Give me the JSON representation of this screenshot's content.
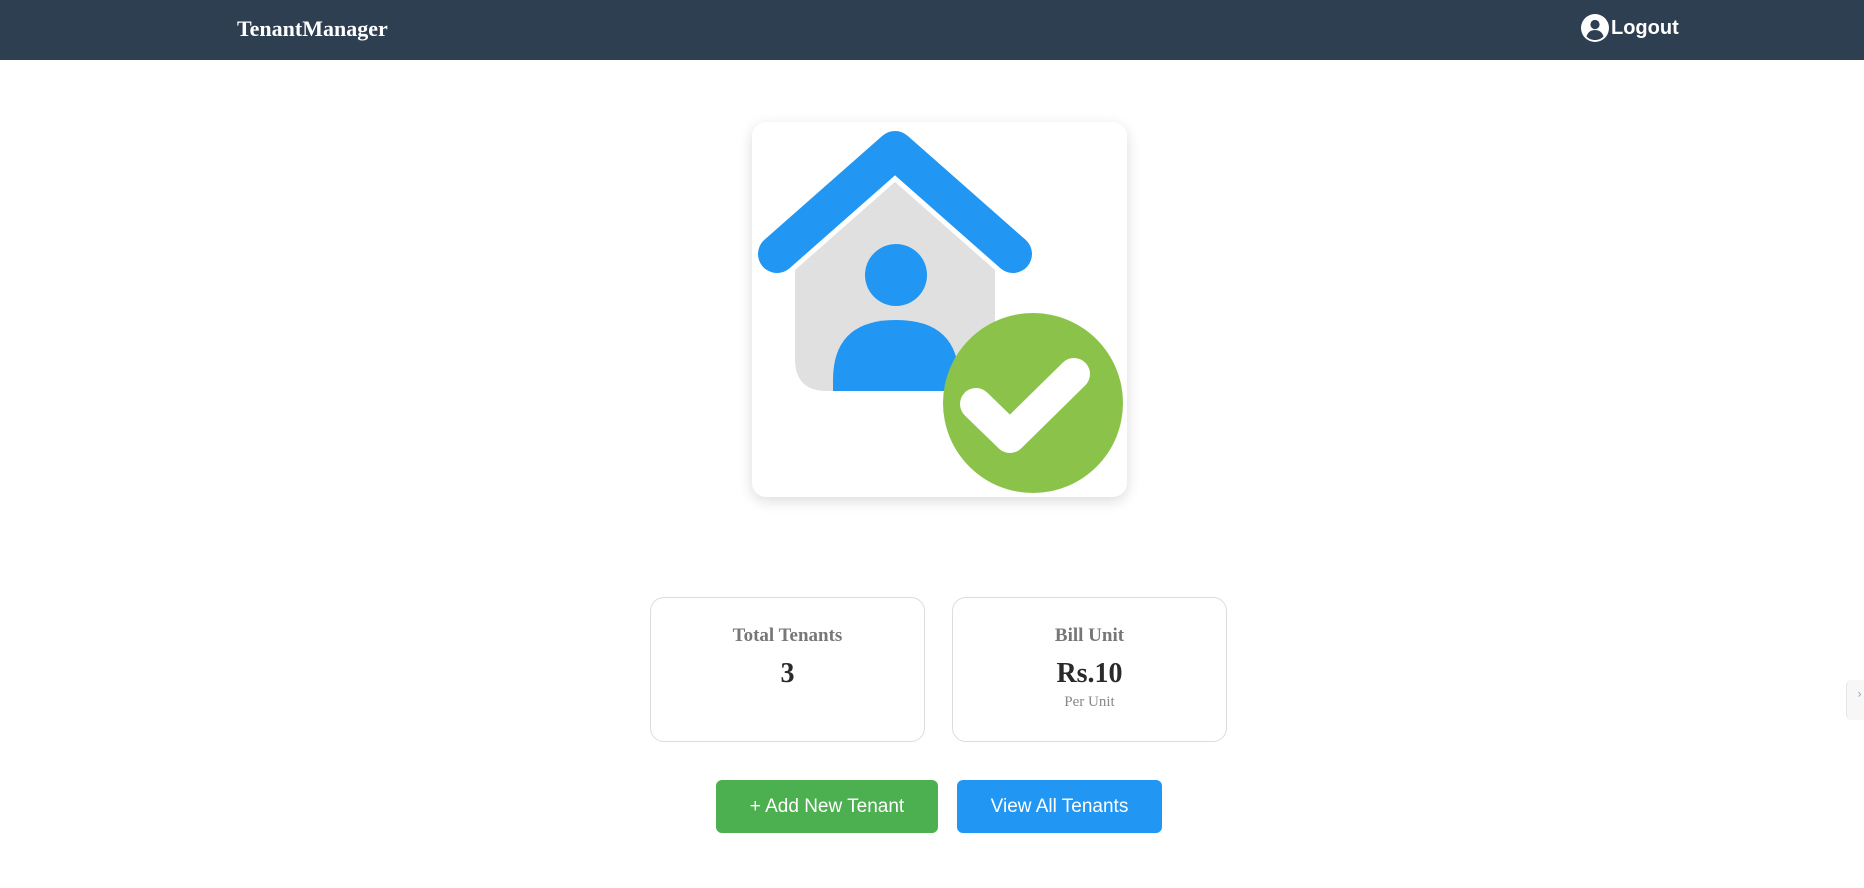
{
  "navbar": {
    "brand": "TenantManager",
    "logout_label": "Logout",
    "logout_icon": "user-circle-icon"
  },
  "hero": {
    "icon": "house-tenant-check-icon",
    "colors": {
      "roof": "#2196f3",
      "person": "#2196f3",
      "house_body": "#e0e0e0",
      "check_circle": "#8bc34a",
      "check_mark": "#ffffff"
    }
  },
  "stats": {
    "total_tenants": {
      "label": "Total Tenants",
      "value": "3"
    },
    "bill_unit": {
      "label": "Bill Unit",
      "value": "Rs.10",
      "sub": "Per Unit"
    }
  },
  "actions": {
    "add_label": "+ Add New Tenant",
    "view_label": "View All Tenants",
    "add_color": "#4caf50",
    "view_color": "#2196f3"
  },
  "edge_tab": {
    "icon": "chevron-right-icon",
    "glyph": "›"
  },
  "colors": {
    "navbar_bg": "#2e3f52"
  }
}
